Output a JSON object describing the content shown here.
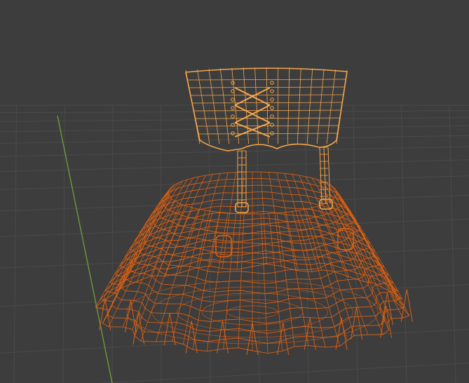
{
  "viewport": {
    "background": "#3d3d3d",
    "grid_color": "#4a4a4a",
    "y_axis_color": "#6f9a3a",
    "selected_object_color": "#e8630f",
    "active_object_color": "#f5a64a"
  },
  "scene": {
    "view_mode": "wireframe",
    "objects": [
      {
        "name_hint": "corset",
        "state": "active-selected"
      },
      {
        "name_hint": "garter-straps",
        "state": "active-selected"
      },
      {
        "name_hint": "ruffled-skirt",
        "state": "selected"
      }
    ]
  }
}
